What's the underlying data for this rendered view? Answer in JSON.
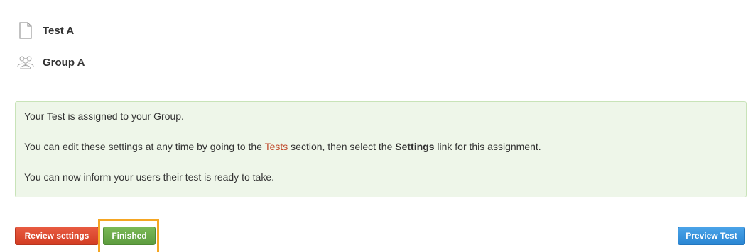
{
  "header": {
    "test_name": "Test A",
    "test_icon": "document-icon",
    "group_name": "Group A",
    "group_icon": "group-users-icon"
  },
  "alert": {
    "line1": "Your Test is assigned to your Group.",
    "line2_prefix": "You can edit these settings at any time by going to the ",
    "line2_link": "Tests",
    "line2_middle": " section, then select the ",
    "line2_bold": "Settings",
    "line2_suffix": " link for this assignment.",
    "line3": "You can now inform your users their test is ready to take."
  },
  "buttons": {
    "review_label": "Review settings",
    "finished_label": "Finished",
    "preview_label": "Preview Test"
  },
  "colors": {
    "alert_background": "#eef6e9",
    "alert_border": "#c8e3b8",
    "link": "#c0492c",
    "review_button": "#d9442a",
    "finished_button": "#6aab4a",
    "preview_button": "#3593dc",
    "highlight": "#f5a623"
  }
}
